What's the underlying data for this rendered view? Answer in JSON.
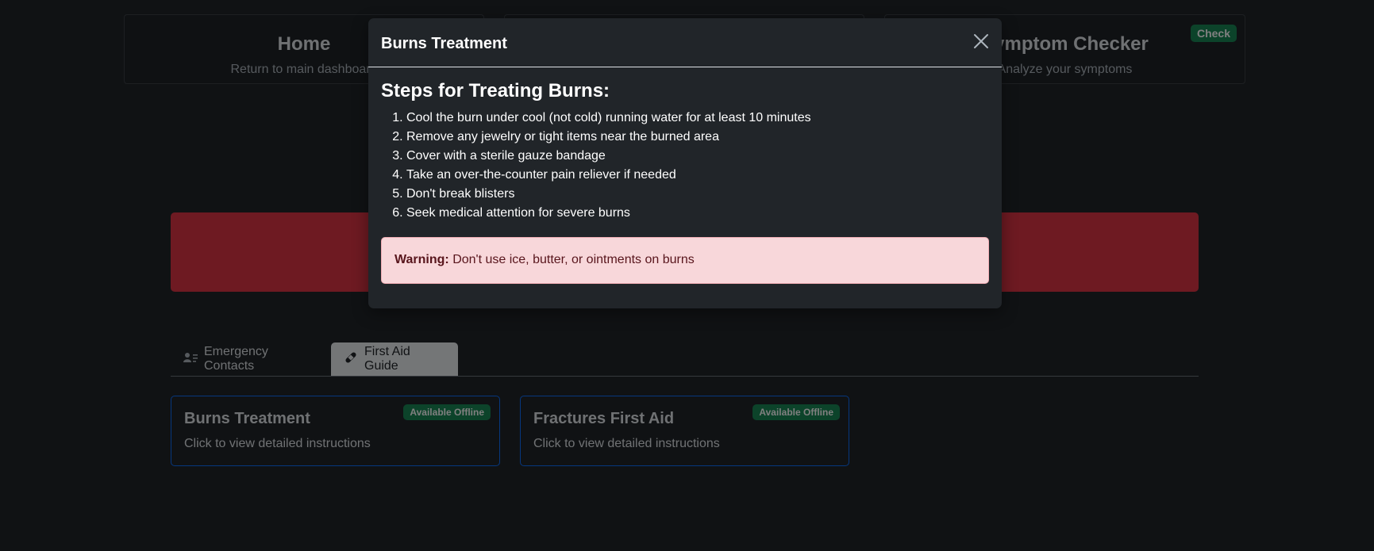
{
  "nav": {
    "home": {
      "title": "Home",
      "subtitle": "Return to main dashboard"
    },
    "middle": {
      "title": "",
      "subtitle": ""
    },
    "symptom": {
      "title": "Symptom Checker",
      "subtitle": "Analyze your symptoms",
      "badge": "Check"
    }
  },
  "tabs": [
    {
      "label": "Emergency Contacts",
      "icon": "contacts-icon",
      "active": false
    },
    {
      "label": "First Aid Guide",
      "icon": "bandage-icon",
      "active": true
    }
  ],
  "guides": [
    {
      "title": "Burns Treatment",
      "subtitle": "Click to view detailed instructions",
      "badge": "Available Offline"
    },
    {
      "title": "Fractures First Aid",
      "subtitle": "Click to view detailed instructions",
      "badge": "Available Offline"
    }
  ],
  "modal": {
    "title": "Burns Treatment",
    "heading": "Steps for Treating Burns:",
    "steps": [
      "Cool the burn under cool (not cold) running water for at least 10 minutes",
      "Remove any jewelry or tight items near the burned area",
      "Cover with a sterile gauze bandage",
      "Take an over-the-counter pain reliever if needed",
      "Don't break blisters",
      "Seek medical attention for severe burns"
    ],
    "warning_label": "Warning:",
    "warning_text": "Don't use ice, butter, or ointments on burns"
  },
  "colors": {
    "background": "#212529",
    "alert": "#dc3545",
    "success_badge": "#198754",
    "card_border": "#0d6efd",
    "warning_bg": "#f8d7da",
    "warning_text": "#58151c"
  }
}
